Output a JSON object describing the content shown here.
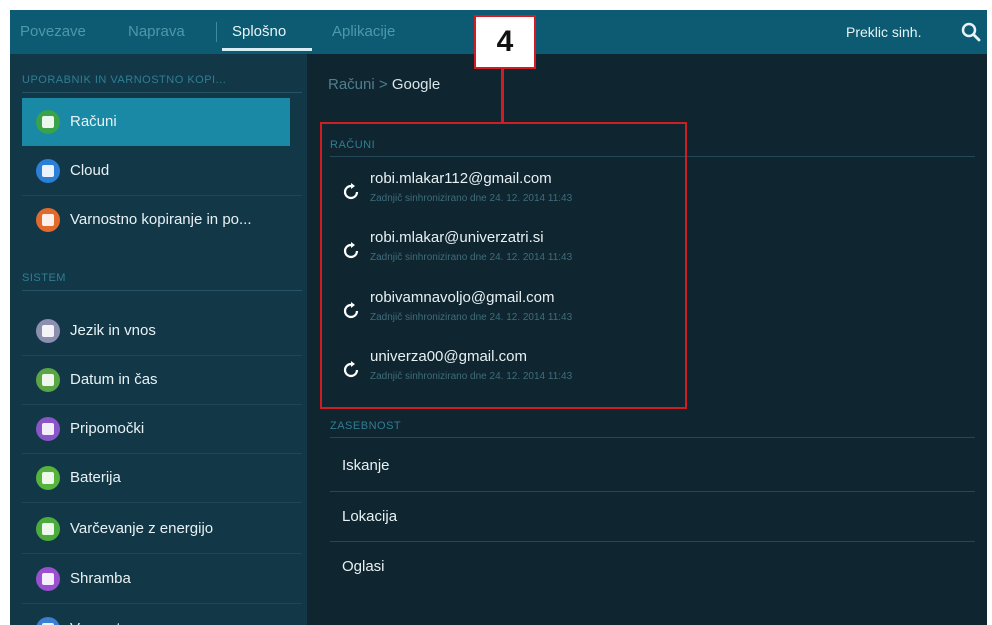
{
  "tabs": [
    {
      "label": "Povezave",
      "active": false
    },
    {
      "label": "Naprava",
      "active": false
    },
    {
      "label": "Splošno",
      "active": true
    },
    {
      "label": "Aplikacije",
      "active": false
    }
  ],
  "topbar": {
    "sync_cancel_label": "Preklic sinh.",
    "search_icon": "search-icon"
  },
  "sidebar": {
    "section_user": "UPORABNIK IN VARNOSTNO KOPI...",
    "section_system": "SISTEM",
    "items": [
      {
        "label": "Računi",
        "icon": "key-icon",
        "color": "#3aa24a",
        "active": true
      },
      {
        "label": "Cloud",
        "icon": "cloud-icon",
        "color": "#2b7fd6"
      },
      {
        "label": "Varnostno kopiranje in po...",
        "icon": "backup-icon",
        "color": "#e26a2c"
      },
      {
        "label": "Jezik in vnos",
        "icon": "keyboard-icon",
        "color": "#8c8fb0"
      },
      {
        "label": "Datum in čas",
        "icon": "calendar-icon",
        "color": "#5aa544"
      },
      {
        "label": "Pripomočki",
        "icon": "accessibility-icon",
        "color": "#8a55c9"
      },
      {
        "label": "Baterija",
        "icon": "battery-icon",
        "color": "#56b33b"
      },
      {
        "label": "Varčevanje z energijo",
        "icon": "power-saving-icon",
        "color": "#4cab3d"
      },
      {
        "label": "Shramba",
        "icon": "storage-icon",
        "color": "#9a4fd0"
      },
      {
        "label": "Varnost",
        "icon": "lock-icon",
        "color": "#3a7fd0"
      }
    ]
  },
  "main": {
    "breadcrumb_parent": "Računi",
    "breadcrumb_separator": ">",
    "breadcrumb_current": "Google",
    "section_accounts": "RAČUNI",
    "accounts": [
      {
        "email": "robi.mlakar112@gmail.com",
        "status": "Zadnjič sinhronizirano dne 24. 12. 2014 11:43"
      },
      {
        "email": "robi.mlakar@univerzatri.si",
        "status": "Zadnjič sinhronizirano dne 24. 12. 2014 11:43"
      },
      {
        "email": "robivamnavoljo@gmail.com",
        "status": "Zadnjič sinhronizirano dne 24. 12. 2014 11:43"
      },
      {
        "email": "univerza00@gmail.com",
        "status": "Zadnjič sinhronizirano dne 24. 12. 2014 11:43"
      }
    ],
    "section_privacy": "ZASEBNOST",
    "privacy_items": [
      {
        "label": "Iskanje"
      },
      {
        "label": "Lokacija"
      },
      {
        "label": "Oglasi"
      }
    ]
  },
  "annotation": {
    "callout_number": "4",
    "color": "#d01d24"
  }
}
